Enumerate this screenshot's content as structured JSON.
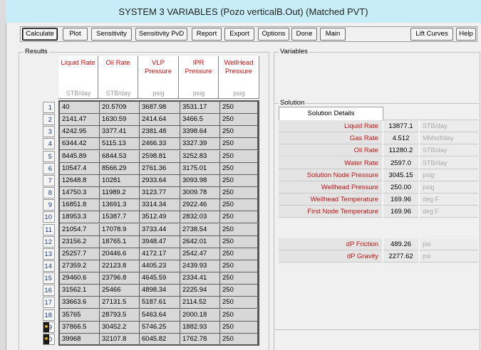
{
  "window": {
    "title": "SYSTEM 3 VARIABLES (Pozo verticalB.Out) (Matched PVT)"
  },
  "toolbar": {
    "calculate": "Calculate",
    "plot": "Plot",
    "sensitivity": "Sensitivity",
    "sensitivity_pvd": "Sensitivity PvD",
    "report": "Report",
    "export": "Export",
    "options": "Options",
    "done": "Done",
    "main": "Main",
    "lift_curves": "Lift Curves",
    "help": "Help"
  },
  "results": {
    "group_label": "Results",
    "columns": [
      {
        "title": [
          "Liquid Rate"
        ],
        "unit": "STB/day"
      },
      {
        "title": [
          "Oil Rate"
        ],
        "unit": "STB/day"
      },
      {
        "title": [
          "VLP Pressure"
        ],
        "unit": "psig"
      },
      {
        "title": [
          "IPR Pressure"
        ],
        "unit": "psig"
      },
      {
        "title": [
          "WellHead",
          "Pressure"
        ],
        "unit": "psig"
      }
    ],
    "rows": [
      {
        "n": "1",
        "liquid": "40",
        "oil": "20.5709",
        "vlp": "3687.98",
        "ipr": "3531.17",
        "whp": "250"
      },
      {
        "n": "2",
        "liquid": "2141.47",
        "oil": "1630.59",
        "vlp": "2414.64",
        "ipr": "3466.5",
        "whp": "250"
      },
      {
        "n": "3",
        "liquid": "4242.95",
        "oil": "3377.41",
        "vlp": "2381.48",
        "ipr": "3398.64",
        "whp": "250"
      },
      {
        "n": "4",
        "liquid": "6344.42",
        "oil": "5115.13",
        "vlp": "2466.33",
        "ipr": "3327.39",
        "whp": "250"
      },
      {
        "n": "5",
        "liquid": "8445.89",
        "oil": "6844.53",
        "vlp": "2598.81",
        "ipr": "3252.83",
        "whp": "250"
      },
      {
        "n": "6",
        "liquid": "10547.4",
        "oil": "8566.29",
        "vlp": "2761.36",
        "ipr": "3175.01",
        "whp": "250"
      },
      {
        "n": "7",
        "liquid": "12648.8",
        "oil": "10281",
        "vlp": "2933.64",
        "ipr": "3093.98",
        "whp": "250"
      },
      {
        "n": "8",
        "liquid": "14750.3",
        "oil": "11989.2",
        "vlp": "3123.77",
        "ipr": "3009.78",
        "whp": "250"
      },
      {
        "n": "9",
        "liquid": "16851.8",
        "oil": "13691.3",
        "vlp": "3314.34",
        "ipr": "2922.46",
        "whp": "250"
      },
      {
        "n": "10",
        "liquid": "18953.3",
        "oil": "15387.7",
        "vlp": "3512.49",
        "ipr": "2832.03",
        "whp": "250"
      },
      {
        "n": "11",
        "liquid": "21054.7",
        "oil": "17078.9",
        "vlp": "3733.44",
        "ipr": "2738.54",
        "whp": "250"
      },
      {
        "n": "12",
        "liquid": "23156.2",
        "oil": "18765.1",
        "vlp": "3948.47",
        "ipr": "2642.01",
        "whp": "250"
      },
      {
        "n": "13",
        "liquid": "25257.7",
        "oil": "20446.6",
        "vlp": "4172.17",
        "ipr": "2542.47",
        "whp": "250"
      },
      {
        "n": "14",
        "liquid": "27359.2",
        "oil": "22123.8",
        "vlp": "4405.23",
        "ipr": "2439.93",
        "whp": "250"
      },
      {
        "n": "15",
        "liquid": "29460.6",
        "oil": "23796.8",
        "vlp": "4645.59",
        "ipr": "2334.41",
        "whp": "250"
      },
      {
        "n": "16",
        "liquid": "31562.1",
        "oil": "25466",
        "vlp": "4898.34",
        "ipr": "2225.94",
        "whp": "250"
      },
      {
        "n": "17",
        "liquid": "33663.6",
        "oil": "27131.5",
        "vlp": "5187.61",
        "ipr": "2114.52",
        "whp": "250"
      },
      {
        "n": "18",
        "liquid": "35765",
        "oil": "28793.5",
        "vlp": "5463.64",
        "ipr": "2000.18",
        "whp": "250"
      },
      {
        "n": "19",
        "liquid": "37866.5",
        "oil": "30452.2",
        "vlp": "5746.25",
        "ipr": "1882.93",
        "whp": "250"
      },
      {
        "n": "20",
        "liquid": "39968",
        "oil": "32107.8",
        "vlp": "6045.82",
        "ipr": "1762.78",
        "whp": "250"
      }
    ]
  },
  "variables": {
    "group_label": "Variables"
  },
  "solution": {
    "group_label": "Solution",
    "details_button": "Solution Details",
    "items": [
      {
        "label": "Liquid Rate",
        "value": "13877.1",
        "unit": "STB/day"
      },
      {
        "label": "Gas Rate",
        "value": "4.512",
        "unit": "MMscf/day"
      },
      {
        "label": "Oil Rate",
        "value": "11280.2",
        "unit": "STB/day"
      },
      {
        "label": "Water Rate",
        "value": "2597.0",
        "unit": "STB/day"
      },
      {
        "label": "Solution Node Pressure",
        "value": "3045.15",
        "unit": "psig"
      },
      {
        "label": "Wellhead Pressure",
        "value": "250.00",
        "unit": "psig"
      },
      {
        "label": "Wellhead Temperature",
        "value": "169.96",
        "unit": "deg F"
      },
      {
        "label": "First Node Temperature",
        "value": "169.96",
        "unit": "deg F"
      }
    ],
    "dp": [
      {
        "label": "dP Friction",
        "value": "489.26",
        "unit": "psi"
      },
      {
        "label": "dP Gravity",
        "value": "2277.62",
        "unit": "psi"
      }
    ]
  }
}
